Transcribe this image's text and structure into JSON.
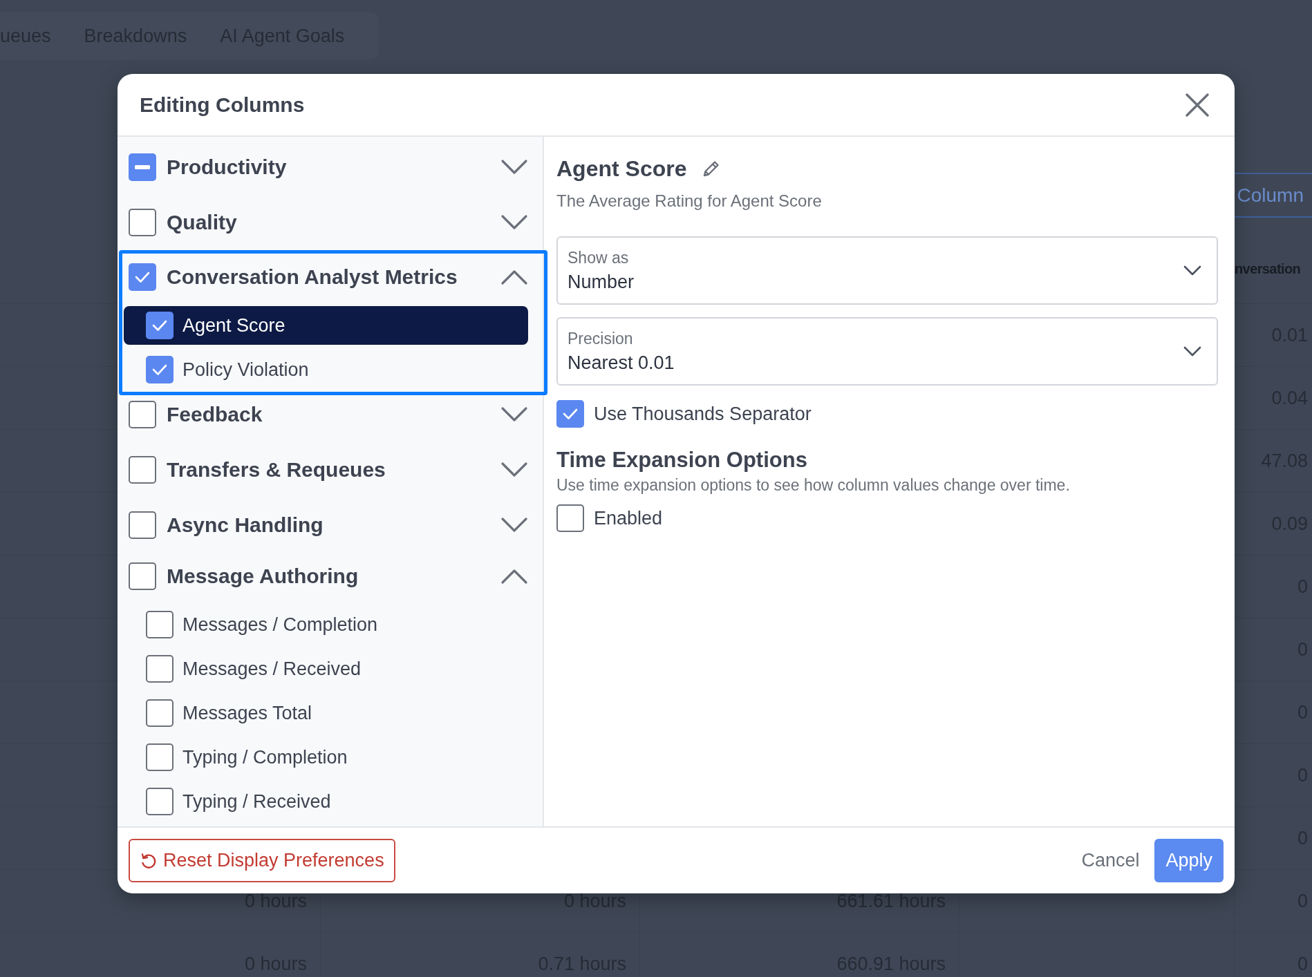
{
  "background": {
    "tabs": [
      {
        "label": "ueues"
      },
      {
        "label": "Breakdowns"
      },
      {
        "label": "AI Agent Goals"
      }
    ],
    "column_button": "Column",
    "table": {
      "header": "nversation",
      "rows": [
        {
          "column_5": "0.01"
        },
        {
          "column_5": "0.04"
        },
        {
          "column_5": "47.08"
        },
        {
          "column_5": "0.09"
        },
        {
          "column_5": "0"
        },
        {
          "column_5": "0"
        },
        {
          "column_5": "0"
        },
        {
          "column_5": "0"
        },
        {
          "column_5": "0"
        },
        {
          "column_1": "0 hours",
          "column_2": "0 hours",
          "column_3": "661.61 hours",
          "column_5": "0"
        },
        {
          "column_1": "0 hours",
          "column_2": "0.71 hours",
          "column_3": "660.91 hours",
          "column_5": "0"
        }
      ]
    }
  },
  "dialog": {
    "title": "Editing Columns",
    "groups": [
      {
        "label": "Productivity",
        "checked": false,
        "partial": true,
        "expanded": false,
        "focused": false
      },
      {
        "label": "Quality",
        "checked": false,
        "partial": false,
        "expanded": false,
        "focused": false
      },
      {
        "label": "Conversation Analyst Metrics",
        "checked": true,
        "partial": false,
        "expanded": true,
        "focused": true,
        "children": [
          {
            "label": "Agent Score",
            "checked": true,
            "selected": true
          },
          {
            "label": "Policy Violation",
            "checked": true,
            "selected": false
          }
        ]
      },
      {
        "label": "Feedback",
        "checked": false,
        "partial": false,
        "expanded": false,
        "focused": false
      },
      {
        "label": "Transfers & Requeues",
        "checked": false,
        "partial": false,
        "expanded": false,
        "focused": false
      },
      {
        "label": "Async Handling",
        "checked": false,
        "partial": false,
        "expanded": false,
        "focused": false
      },
      {
        "label": "Message Authoring",
        "checked": false,
        "partial": false,
        "expanded": true,
        "focused": false,
        "children": [
          {
            "label": "Messages / Completion",
            "checked": false,
            "selected": false
          },
          {
            "label": "Messages / Received",
            "checked": false,
            "selected": false
          },
          {
            "label": "Messages Total",
            "checked": false,
            "selected": false
          },
          {
            "label": "Typing / Completion",
            "checked": false,
            "selected": false
          },
          {
            "label": "Typing / Received",
            "checked": false,
            "selected": false
          }
        ]
      }
    ],
    "detail": {
      "title": "Agent Score",
      "description": "The Average Rating for Agent Score",
      "selects": [
        {
          "label": "Show as",
          "value": "Number"
        },
        {
          "label": "Precision",
          "value": "Nearest 0.01"
        }
      ],
      "thousands_separator": {
        "label": "Use Thousands Separator",
        "checked": true
      },
      "time_expansion": {
        "title": "Time Expansion Options",
        "description": "Use time expansion options to see how column values change over time.",
        "enabled": {
          "label": "Enabled",
          "checked": false
        }
      }
    },
    "footer": {
      "reset": "Reset Display Preferences",
      "cancel": "Cancel",
      "apply": "Apply"
    }
  }
}
